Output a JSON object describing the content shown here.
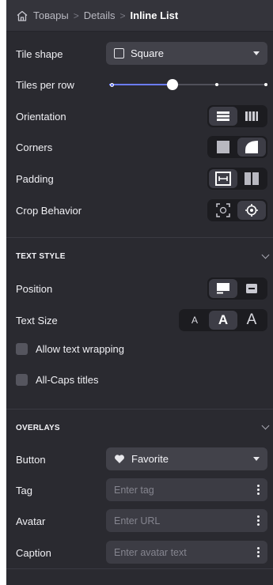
{
  "breadcrumb": {
    "items": [
      "Товары",
      "Details",
      "Inline List"
    ],
    "separator": ">"
  },
  "layout": {
    "tile_shape": {
      "label": "Tile shape",
      "value": "Square"
    },
    "tiles_per_row": {
      "label": "Tiles per row",
      "level_fraction": 0.4
    },
    "orientation": {
      "label": "Orientation",
      "options": [
        "rows-icon",
        "columns-icon"
      ],
      "selected": "rows-icon"
    },
    "corners": {
      "label": "Corners",
      "options": [
        "square-corner-icon",
        "round-corner-icon"
      ],
      "selected": "round-corner-icon"
    },
    "padding": {
      "label": "Padding",
      "options": [
        "padding-icon",
        "no-padding-icon"
      ],
      "selected": "padding-icon"
    },
    "crop": {
      "label": "Crop Behavior",
      "options": [
        "face-crop-icon",
        "focus-crop-icon"
      ],
      "selected": "focus-crop-icon"
    }
  },
  "text_style": {
    "header": "TEXT STYLE",
    "position": {
      "label": "Position",
      "options": [
        "text-below-icon",
        "text-overlay-icon"
      ],
      "selected": "text-below-icon"
    },
    "text_size": {
      "label": "Text Size",
      "options": [
        "A",
        "A",
        "A"
      ],
      "selected_index": 1
    },
    "wrap": {
      "label": "Allow text wrapping",
      "checked": false
    },
    "caps": {
      "label": "All-Caps titles",
      "checked": false
    }
  },
  "overlays": {
    "header": "OVERLAYS",
    "button": {
      "label": "Button",
      "value": "Favorite",
      "icon": "heart-icon"
    },
    "tag": {
      "label": "Tag",
      "placeholder": "Enter tag"
    },
    "avatar": {
      "label": "Avatar",
      "placeholder": "Enter URL"
    },
    "caption": {
      "label": "Caption",
      "placeholder": "Enter avatar text"
    }
  },
  "colors": {
    "panel": "#2a2a30",
    "accent": "#6b7cff",
    "control": "#42424a"
  }
}
